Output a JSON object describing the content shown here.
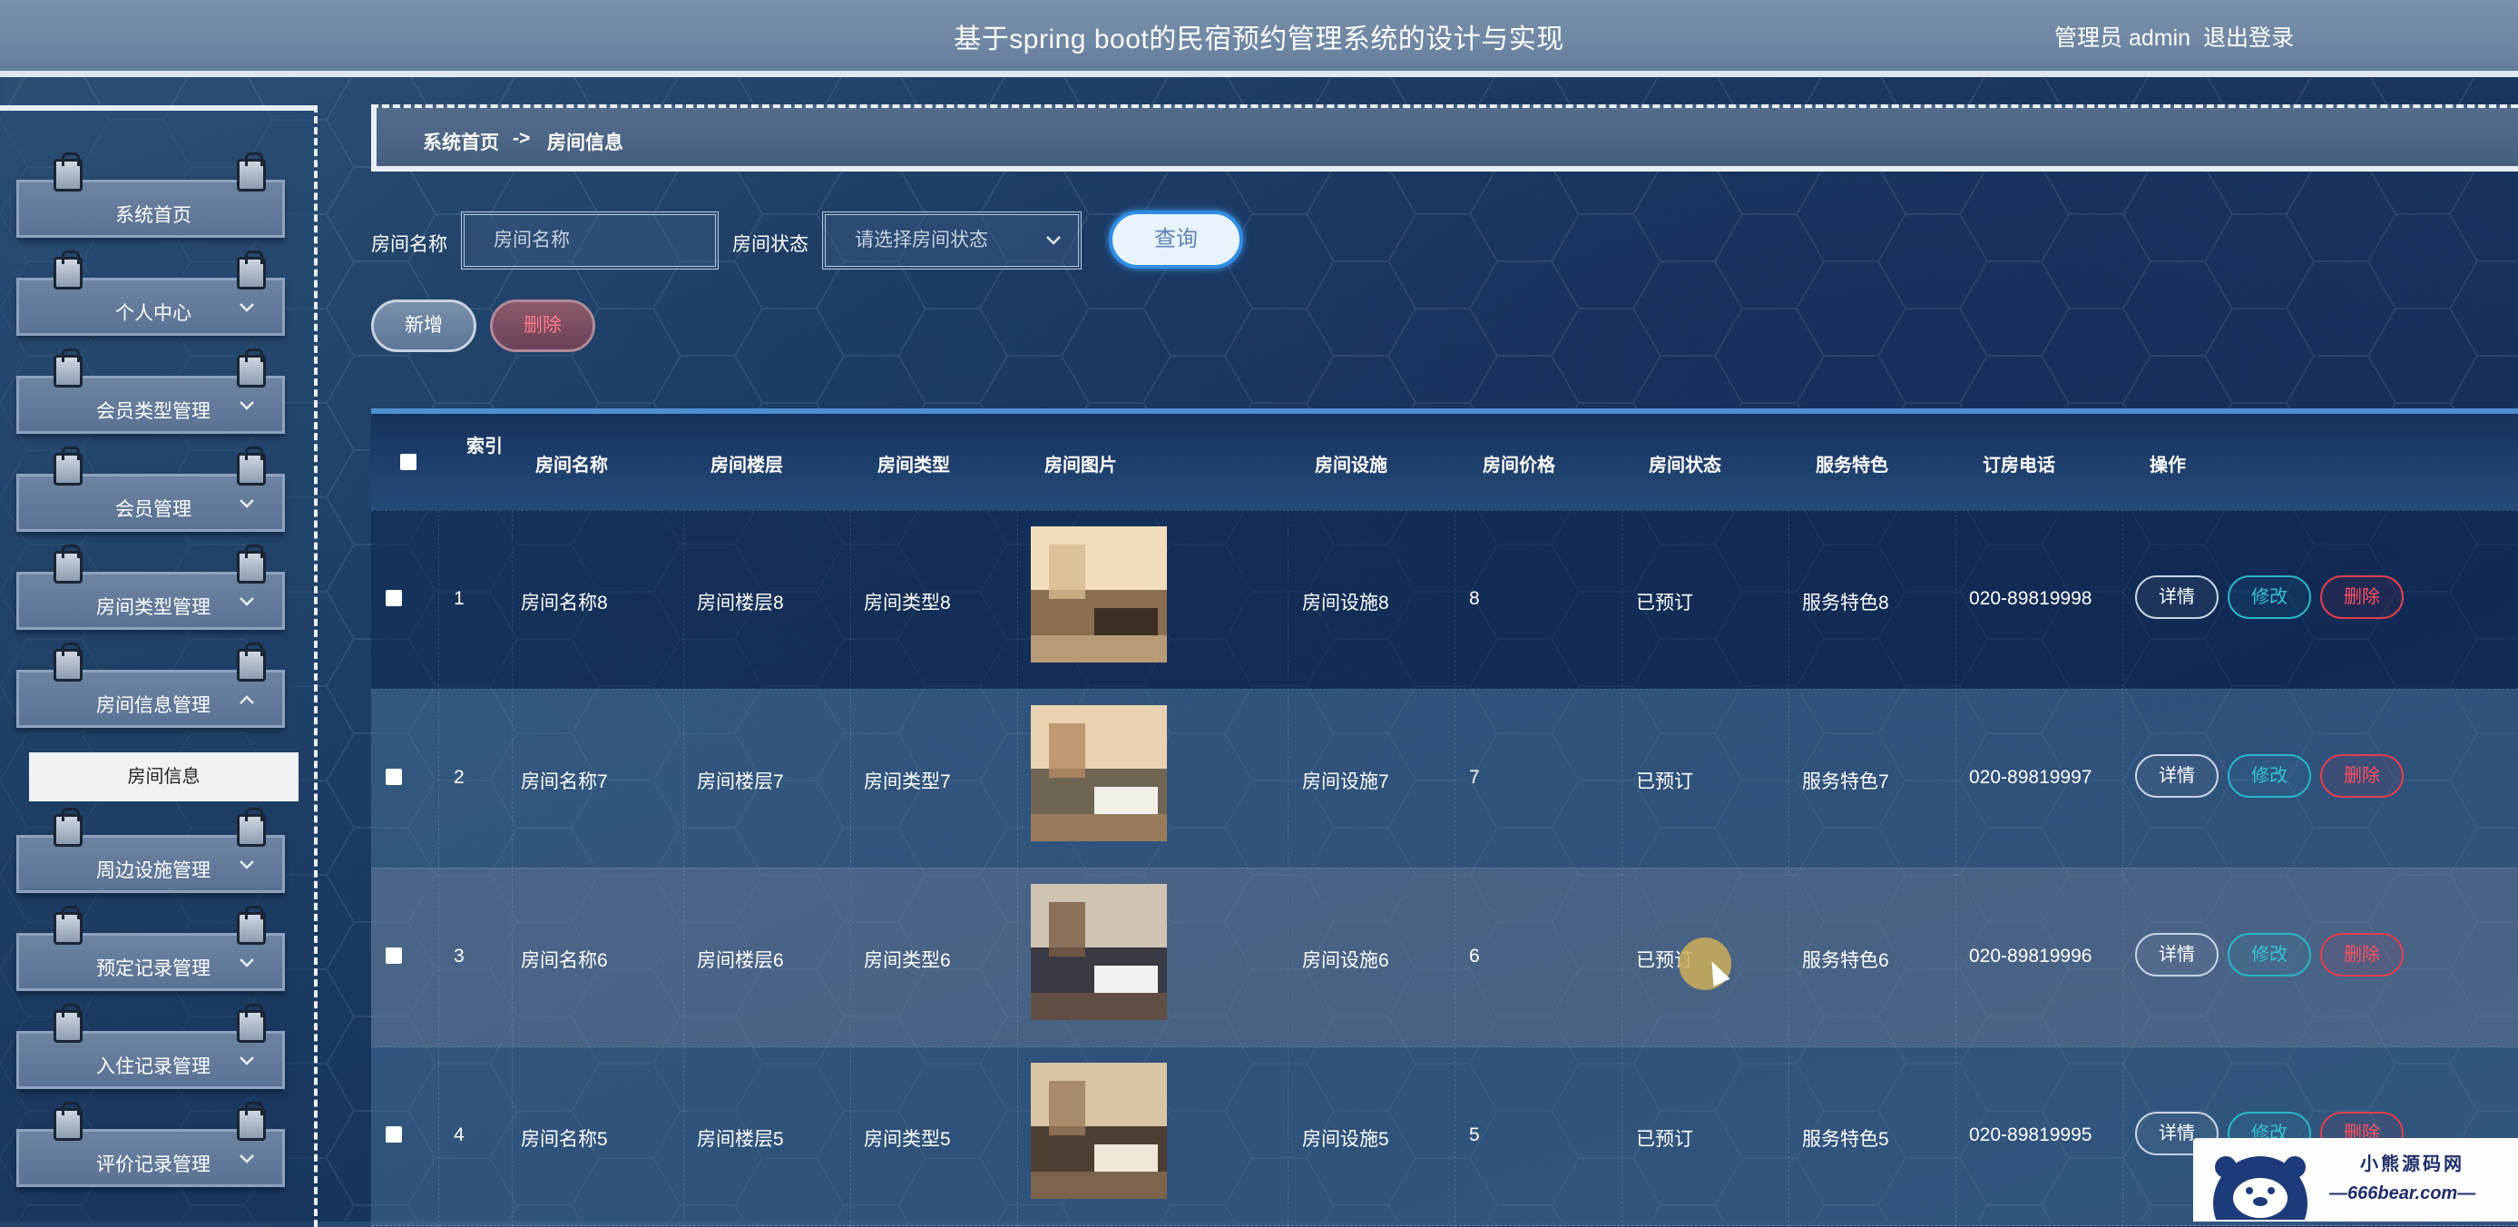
{
  "header": {
    "title": "基于spring boot的民宿预约管理系统的设计与实现",
    "admin_label": "管理员 admin",
    "logout_label": "退出登录"
  },
  "sidebar": {
    "items": [
      {
        "label": "系统首页",
        "expandable": false
      },
      {
        "label": "个人中心",
        "expandable": true,
        "state": "collapsed"
      },
      {
        "label": "会员类型管理",
        "expandable": true,
        "state": "collapsed"
      },
      {
        "label": "会员管理",
        "expandable": true,
        "state": "collapsed"
      },
      {
        "label": "房间类型管理",
        "expandable": true,
        "state": "collapsed"
      },
      {
        "label": "房间信息管理",
        "expandable": true,
        "state": "expanded"
      },
      {
        "label": "周边设施管理",
        "expandable": true,
        "state": "collapsed"
      },
      {
        "label": "预定记录管理",
        "expandable": true,
        "state": "collapsed"
      },
      {
        "label": "入住记录管理",
        "expandable": true,
        "state": "collapsed"
      },
      {
        "label": "评价记录管理",
        "expandable": true,
        "state": "collapsed"
      }
    ],
    "submenu_active": "房间信息"
  },
  "breadcrumb": {
    "home": "系统首页",
    "separator": "->",
    "current": "房间信息"
  },
  "filter": {
    "name_label": "房间名称",
    "name_placeholder": "房间名称",
    "status_label": "房间状态",
    "status_placeholder": "请选择房间状态",
    "query_button": "查询"
  },
  "actions": {
    "add_button": "新增",
    "delete_button": "删除"
  },
  "table": {
    "headers": [
      "索引",
      "房间名称",
      "房间楼层",
      "房间类型",
      "房间图片",
      "房间设施",
      "房间价格",
      "房间状态",
      "服务特色",
      "订房电话",
      "操作"
    ],
    "rows": [
      {
        "index": "1",
        "name": "房间名称8",
        "floor": "房间楼层8",
        "type": "房间类型8",
        "facility": "房间设施8",
        "price": "8",
        "status": "已预订",
        "feature": "服务特色8",
        "phone": "020-89819998"
      },
      {
        "index": "2",
        "name": "房间名称7",
        "floor": "房间楼层7",
        "type": "房间类型7",
        "facility": "房间设施7",
        "price": "7",
        "status": "已预订",
        "feature": "服务特色7",
        "phone": "020-89819997"
      },
      {
        "index": "3",
        "name": "房间名称6",
        "floor": "房间楼层6",
        "type": "房间类型6",
        "facility": "房间设施6",
        "price": "6",
        "status": "已预订",
        "feature": "服务特色6",
        "phone": "020-89819996"
      },
      {
        "index": "4",
        "name": "房间名称5",
        "floor": "房间楼层5",
        "type": "房间类型5",
        "facility": "房间设施5",
        "price": "5",
        "status": "已预订",
        "feature": "服务特色5",
        "phone": "020-89819995"
      }
    ],
    "row_actions": {
      "detail": "详情",
      "edit": "修改",
      "remove": "删除"
    }
  },
  "watermark": {
    "name": "小熊源码网",
    "url": "—666bear.com—"
  },
  "icons": {
    "chevron_down": "chevron-down-icon",
    "chevron_up": "chevron-up-icon",
    "select_arrow": "chevron-down-icon"
  },
  "colors": {
    "accent": "#2e8ee6",
    "danger": "#e0404e",
    "edit": "#2ab6c9"
  }
}
